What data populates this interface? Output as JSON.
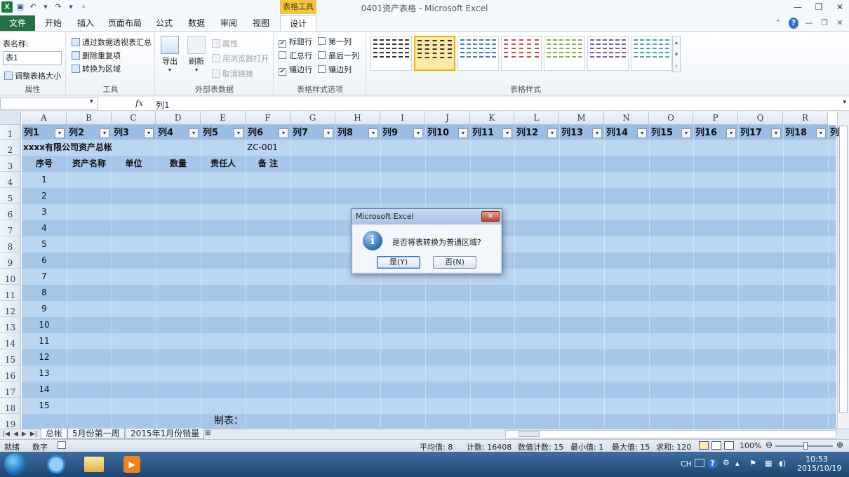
{
  "app": {
    "window_title": "0401资产表格 - Microsoft Excel",
    "contextual_tab_group": "表格工具"
  },
  "ribbon_tabs": [
    "文件",
    "开始",
    "插入",
    "页面布局",
    "公式",
    "数据",
    "审阅",
    "视图",
    "设计"
  ],
  "ribbon": {
    "properties": {
      "table_name_label": "表名称:",
      "table_name_value": "表1",
      "resize_label": "调整表格大小",
      "group_label": "属性"
    },
    "tools": {
      "pivot": "通过数据透视表汇总",
      "remove_dup": "删除重复项",
      "convert": "转换为区域",
      "group_label": "工具"
    },
    "external": {
      "export": "导出",
      "refresh": "刷新",
      "properties": "属性",
      "open_browser": "用浏览器打开",
      "unlink": "取消链接",
      "group_label": "外部表数据"
    },
    "style_options": {
      "header_row": "标题行",
      "total_row": "汇总行",
      "banded_rows": "镶边行",
      "first_column": "第一列",
      "last_column": "最后一列",
      "banded_columns": "镶边列",
      "header_row_checked": true,
      "total_row_checked": false,
      "banded_rows_checked": true,
      "first_column_checked": false,
      "last_column_checked": false,
      "banded_columns_checked": false,
      "group_label": "表格样式选项"
    },
    "table_styles": {
      "group_label": "表格样式",
      "swatch_colors": [
        "#333333",
        "#333333",
        "#4a78b8",
        "#c94a4a",
        "#8ab04a",
        "#7a5aa8",
        "#45a7b8"
      ],
      "selected_index": 1
    }
  },
  "formula_bar": {
    "name_box": "",
    "fx": "fx",
    "value": "列1"
  },
  "grid": {
    "columns": [
      "A",
      "B",
      "C",
      "D",
      "E",
      "F",
      "G",
      "H",
      "I",
      "J",
      "K",
      "L",
      "M",
      "N",
      "O",
      "P",
      "Q",
      "R"
    ],
    "rows": [
      "1",
      "2",
      "3",
      "4",
      "5",
      "6",
      "7",
      "8",
      "9",
      "10",
      "11",
      "12",
      "13",
      "14",
      "15",
      "16",
      "17",
      "18",
      "19"
    ],
    "table_headers": [
      "列1",
      "列2",
      "列3",
      "列4",
      "列5",
      "列6",
      "列7",
      "列8",
      "列9",
      "列10",
      "列11",
      "列12",
      "列13",
      "列14",
      "列15",
      "列16",
      "列17",
      "列18",
      "列"
    ],
    "title": "xxxx有限公司资产总帐",
    "code": "ZC-001",
    "field_headers": [
      "序号",
      "资产名称",
      "单位",
      "数量",
      "责任人",
      "备  注"
    ],
    "serials": [
      "1",
      "2",
      "3",
      "4",
      "5",
      "6",
      "7",
      "8",
      "9",
      "10",
      "11",
      "12",
      "13",
      "14",
      "15"
    ],
    "footer_label": "制表：",
    "band_colors": [
      "#a7c7ea",
      "#bcd6f1"
    ],
    "header_band_color": "#9bbde3"
  },
  "sheet_tabs": [
    "总帐",
    "5月份第一周",
    "2015年1月份销量"
  ],
  "status_bar": {
    "ready": "就绪",
    "mode": "数字",
    "average": "平均值: 8",
    "count": "计数: 16408",
    "numeric_count": "数值计数: 15",
    "min": "最小值: 1",
    "max": "最大值: 15",
    "sum": "求和: 120",
    "zoom": "100%"
  },
  "dialog": {
    "title": "Microsoft Excel",
    "message": "是否将表转换为普通区域?",
    "yes": "是(Y)",
    "no": "否(N)"
  },
  "taskbar": {
    "ime": "CH",
    "time": "10:53",
    "date": "2015/10/19"
  }
}
